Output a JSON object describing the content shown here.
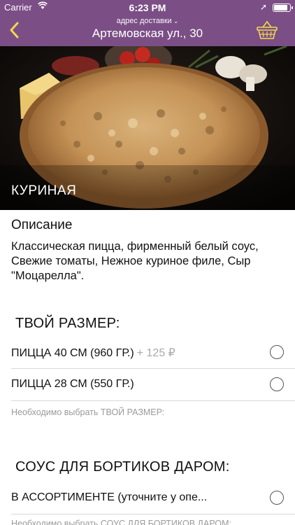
{
  "status_bar": {
    "carrier": "Carrier",
    "time": "6:23 PM",
    "battery_level": 0.9
  },
  "nav": {
    "subtitle": "адрес доставки",
    "address": "Артемовская ул., 30",
    "accent_color": "#7b4f86"
  },
  "product": {
    "name": "КУРИНАЯ",
    "description_title": "Описание",
    "description": "Классическая пицца, фирменный белый  соус, Свежие томаты, Нежное куриное филе, Сыр \"Моцарелла\"."
  },
  "groups": [
    {
      "title": "ТВОЙ РАЗМЕР:",
      "options": [
        {
          "label": "ПИЦЦА 40 СМ (960 ГР.)",
          "price": "+ 125 ₽",
          "selected": false
        },
        {
          "label": "ПИЦЦА 28 СМ (550 ГР.)",
          "price": "",
          "selected": false
        }
      ],
      "hint": "Необходимо выбрать ТВОЙ РАЗМЕР:"
    },
    {
      "title": "СОУС ДЛЯ БОРТИКОВ ДАРОМ:",
      "options": [
        {
          "label": "В АССОРТИМЕНТЕ (уточните у опе...",
          "price": "",
          "selected": false
        }
      ],
      "hint": "Необходимо выбрать СОУС ДЛЯ БОРТИКОВ ДАРОМ:"
    }
  ]
}
